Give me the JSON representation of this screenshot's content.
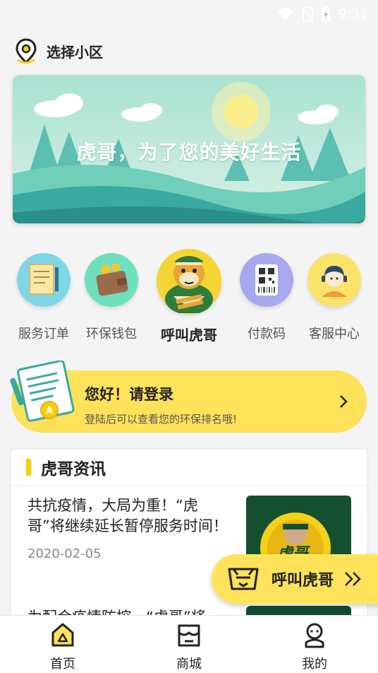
{
  "status_bar": {
    "time": "9:31",
    "icons": [
      "wifi-icon",
      "no-sim-icon",
      "battery-charging-icon"
    ]
  },
  "location": {
    "label": "选择小区",
    "icon": "location-pin-icon"
  },
  "banner": {
    "title": "虎哥，为了您的美好生活"
  },
  "menu": {
    "items": [
      {
        "label": "服务订单",
        "icon": "document-icon"
      },
      {
        "label": "环保钱包",
        "icon": "wallet-icon"
      },
      {
        "label": "呼叫虎哥",
        "icon": "tiger-mascot-icon"
      },
      {
        "label": "付款码",
        "icon": "qr-code-icon"
      },
      {
        "label": "客服中心",
        "icon": "customer-service-icon"
      }
    ]
  },
  "login_card": {
    "title": "您好！请登录",
    "subtitle": "登陆后可以查看您的环保排名哦!"
  },
  "news": {
    "section_title": "虎哥资讯",
    "items": [
      {
        "title": "共抗疫情，大局为重！“虎哥”将继续延长暂停服务时间！",
        "date": "2020-02-05",
        "thumb_text": "虎哥"
      },
      {
        "title": "为配合疫情防控，“虎哥”将"
      }
    ]
  },
  "call_float": {
    "label": "呼叫虎哥"
  },
  "tabbar": {
    "tabs": [
      {
        "label": "首页",
        "icon": "home-icon",
        "active": true
      },
      {
        "label": "商城",
        "icon": "shop-icon",
        "active": false
      },
      {
        "label": "我的",
        "icon": "profile-icon",
        "active": false
      }
    ]
  },
  "colors": {
    "accent": "#fde25a",
    "banner_top": "#8fd9c4",
    "banner_bottom": "#3aa9a0"
  }
}
